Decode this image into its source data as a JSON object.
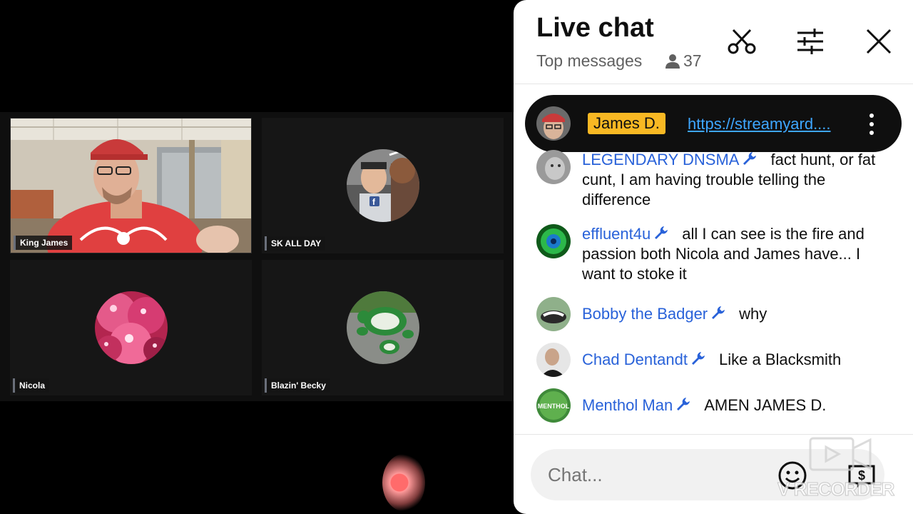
{
  "participants": [
    {
      "name": "King James"
    },
    {
      "name": "SK ALL DAY"
    },
    {
      "name": "Nicola"
    },
    {
      "name": "Blazin' Becky"
    }
  ],
  "chat": {
    "title": "Live chat",
    "filter_label": "Top messages",
    "viewer_count": "37",
    "pinned": {
      "author": "James D.",
      "link_text": "https://streamyard...."
    },
    "messages": [
      {
        "author": "LEGENDARY DNSMA",
        "text": "fact hunt, or fat cunt, I am having trouble telling the difference"
      },
      {
        "author": "effluent4u",
        "text": "all I can see is the fire and passion both Nicola and James have... I want to stoke it"
      },
      {
        "author": "Bobby the Badger",
        "text": "why"
      },
      {
        "author": "Chad Dentandt",
        "text": "Like a Blacksmith"
      },
      {
        "author": "Menthol Man",
        "text": "AMEN JAMES D."
      }
    ],
    "input_placeholder": "Chat...",
    "menthol_avatar_text": "MENTHOL"
  },
  "icons": {
    "scissors": "scissors-icon",
    "filter": "sliders-icon",
    "close": "close-icon",
    "person": "person-icon",
    "wrench": "wrench-icon",
    "more": "more-vert-icon",
    "emoji": "emoji-icon",
    "super_chat": "dollar-icon"
  },
  "watermark": "V RECORDER",
  "colors": {
    "author_blue": "#2962d9",
    "pinned_badge": "#f8b823",
    "link_blue": "#3ea6ff"
  }
}
